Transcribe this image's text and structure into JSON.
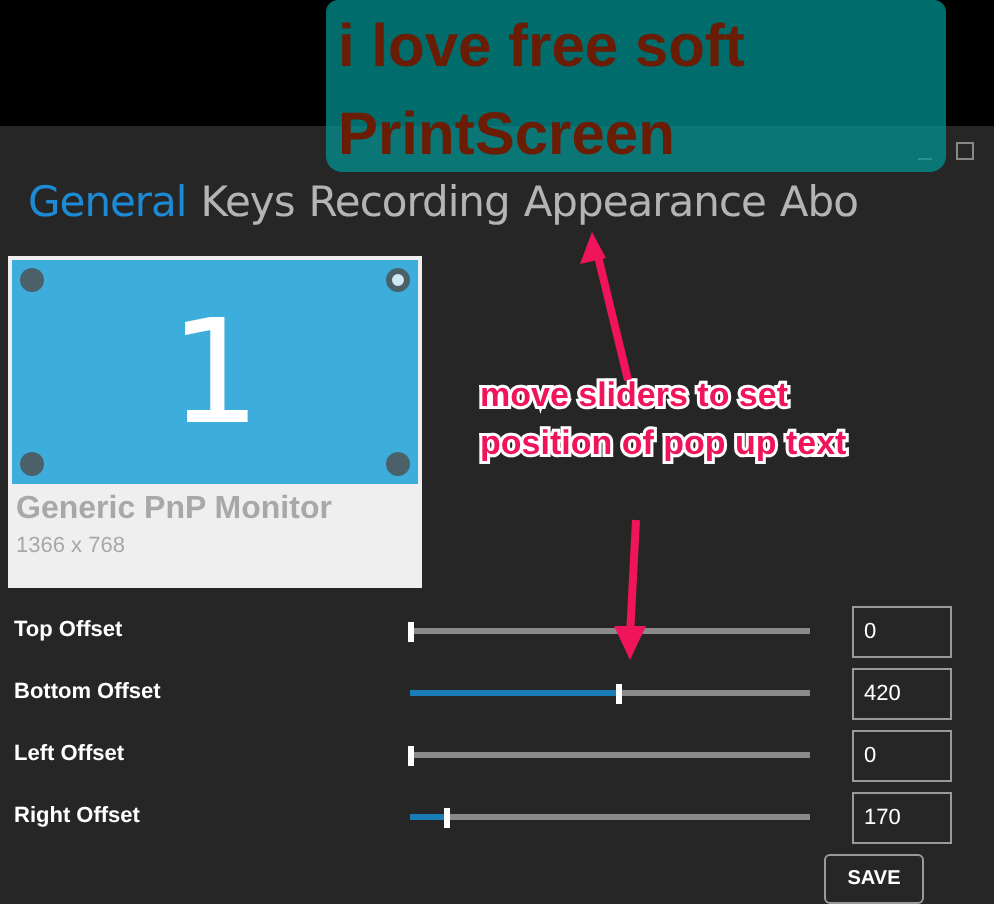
{
  "popup_text": {
    "lines": [
      "i love free soft",
      "PrintScreen"
    ]
  },
  "tabs": [
    {
      "label": "General",
      "selected": true
    },
    {
      "label": "Keys",
      "selected": false
    },
    {
      "label": "Recording",
      "selected": false
    },
    {
      "label": "Appearance",
      "selected": false
    },
    {
      "label": "Abo",
      "selected": false
    }
  ],
  "monitor": {
    "number": "1",
    "name": "Generic PnP Monitor",
    "resolution": "1366 x 768",
    "corners": [
      {
        "selected": false
      },
      {
        "selected": true
      },
      {
        "selected": false
      },
      {
        "selected": false
      }
    ]
  },
  "offsets": [
    {
      "label": "Top Offset",
      "level": 0,
      "value": "0"
    },
    {
      "label": "Bottom Offset",
      "level": 0.52,
      "value": "420"
    },
    {
      "label": "Left Offset",
      "level": 0,
      "value": "0"
    },
    {
      "label": "Right Offset",
      "level": 0.09,
      "value": "170"
    }
  ],
  "save_button": "SAVE",
  "annotation": {
    "text": "move sliders to set position of pop up text"
  }
}
